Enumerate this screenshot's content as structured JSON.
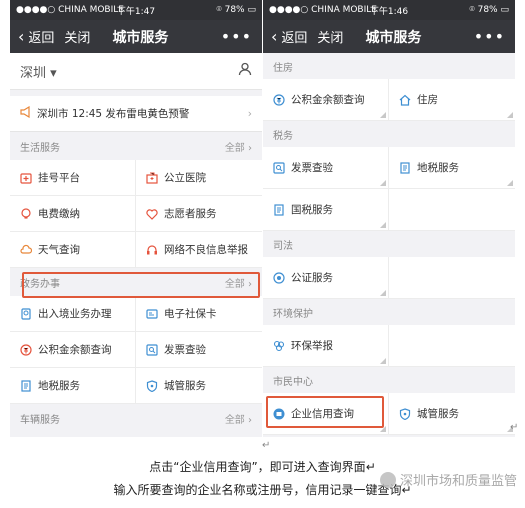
{
  "left": {
    "status": {
      "carrier": "●●●●○ CHINA MOBILE ",
      "time": "下午1:47",
      "battery": "78%"
    },
    "nav": {
      "back": "返回",
      "close": "关闭",
      "title": "城市服务",
      "more": "•••"
    },
    "city": "深圳",
    "alert": "深圳市 12:45 发布雷电黄色预警",
    "sections": [
      {
        "title": "生活服务",
        "all": "全部",
        "items": [
          {
            "label": "挂号平台",
            "icon": "hospital-register-icon",
            "color": "#e5533d"
          },
          {
            "label": "公立医院",
            "icon": "hospital-building-icon",
            "color": "#e5533d"
          },
          {
            "label": "电费缴纳",
            "icon": "electricity-bulb-icon",
            "color": "#e5533d"
          },
          {
            "label": "志愿者服务",
            "icon": "heart-icon",
            "color": "#e5533d"
          },
          {
            "label": "天气查询",
            "icon": "weather-cloud-icon",
            "color": "#e8873a"
          },
          {
            "label": "网络不良信息举报",
            "icon": "headset-icon",
            "color": "#e5533d"
          }
        ]
      },
      {
        "title": "政务办事",
        "all": "全部",
        "items": [
          {
            "label": "出入境业务办理",
            "icon": "passport-icon",
            "color": "#3f8fd2"
          },
          {
            "label": "电子社保卡",
            "icon": "id-card-icon",
            "color": "#3f8fd2"
          },
          {
            "label": "公积金余额查询",
            "icon": "fund-icon",
            "color": "#e5533d"
          },
          {
            "label": "发票查验",
            "icon": "invoice-icon",
            "color": "#3f8fd2"
          },
          {
            "label": "地税服务",
            "icon": "tax-document-icon",
            "color": "#3f8fd2"
          },
          {
            "label": "城管服务",
            "icon": "shield-icon",
            "color": "#3f8fd2"
          }
        ]
      },
      {
        "title": "车辆服务",
        "all": "全部",
        "items": []
      }
    ]
  },
  "right": {
    "status": {
      "carrier": "●●●●○ CHINA MOBILE ",
      "time": "下午1:46",
      "battery": "78%"
    },
    "nav": {
      "back": "返回",
      "close": "关闭",
      "title": "城市服务",
      "more": "•••"
    },
    "sections": [
      {
        "title": "住房",
        "items": [
          {
            "label": "公积金余额查询",
            "icon": "fund-icon",
            "color": "#3f8fd2"
          },
          {
            "label": "住房",
            "icon": "house-icon",
            "color": "#3f8fd2"
          }
        ]
      },
      {
        "title": "税务",
        "items": [
          {
            "label": "发票查验",
            "icon": "invoice-icon",
            "color": "#3f8fd2"
          },
          {
            "label": "地税服务",
            "icon": "tax-document-icon",
            "color": "#3f8fd2"
          },
          {
            "label": "国税服务",
            "icon": "tax-document-icon",
            "color": "#3f8fd2"
          }
        ]
      },
      {
        "title": "司法",
        "items": [
          {
            "label": "公证服务",
            "icon": "notary-seal-icon",
            "color": "#3f8fd2"
          }
        ]
      },
      {
        "title": "环境保护",
        "items": [
          {
            "label": "环保举报",
            "icon": "leaf-icon",
            "color": "#3f8fd2"
          }
        ]
      },
      {
        "title": "市民中心",
        "items": [
          {
            "label": "企业信用查询",
            "icon": "enterprise-credit-icon",
            "color": "#3f8fd2"
          },
          {
            "label": "城管服务",
            "icon": "shield-icon",
            "color": "#3f8fd2"
          }
        ]
      }
    ]
  },
  "caption": {
    "line1": "点击“企业信用查询”，即可进入查询界面",
    "line2": "输入所要查询的企业名称或注册号，信用记录一键查询"
  },
  "watermark": "深圳市场和质量监管",
  "colors": {
    "highlight": "#e0593a",
    "nav_bg": "#36373c",
    "status_bg": "#303135"
  }
}
